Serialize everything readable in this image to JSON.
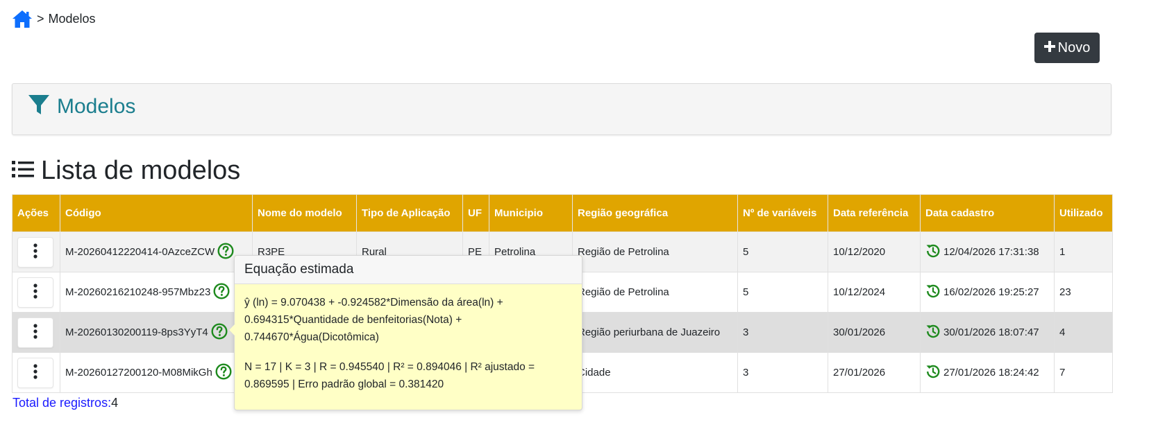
{
  "breadcrumb": {
    "separator": ">",
    "current": "Modelos"
  },
  "toolbar": {
    "novo_label": "Novo"
  },
  "filter_panel": {
    "title": "Modelos"
  },
  "list": {
    "title": "Lista de modelos"
  },
  "table": {
    "headers": [
      "Ações",
      "Código",
      "Nome do modelo",
      "Tipo de Aplicação",
      "UF",
      "Municipio",
      "Região geográfica",
      "Nº de variáveis",
      "Data referência",
      "Data cadastro",
      "Utilizado"
    ],
    "rows": [
      {
        "codigo": "M-20260412220414-0AzceZCW",
        "nome": "R3PE",
        "tipo": "Rural",
        "uf": "PE",
        "municipio": "Petrolina",
        "regiao": "Região de Petrolina",
        "variaveis": "5",
        "data_ref": "10/12/2020",
        "data_cadastro": "12/04/2026 17:31:38",
        "utilizado": "1"
      },
      {
        "codigo": "M-20260216210248-957Mbz23",
        "nome": "",
        "tipo": "",
        "uf": "",
        "municipio": "",
        "regiao": "Região de Petrolina",
        "variaveis": "5",
        "data_ref": "10/12/2024",
        "data_cadastro": "16/02/2026 19:25:27",
        "utilizado": "23"
      },
      {
        "codigo": "M-20260130200119-8ps3YyT4",
        "nome": "",
        "tipo": "",
        "uf": "",
        "municipio": "",
        "regiao": "Região periurbana de Juazeiro",
        "variaveis": "3",
        "data_ref": "30/01/2026",
        "data_cadastro": "30/01/2026 18:07:47",
        "utilizado": "4"
      },
      {
        "codigo": "M-20260127200120-M08MikGh",
        "nome": "",
        "tipo": "",
        "uf": "",
        "municipio": "",
        "regiao": "Cidade",
        "variaveis": "3",
        "data_ref": "27/01/2026",
        "data_cadastro": "27/01/2026 18:24:42",
        "utilizado": "7"
      }
    ]
  },
  "total": {
    "label": "Total de registros:",
    "value": "4"
  },
  "popover": {
    "title": "Equação estimada",
    "equation": "ŷ (ln) = 9.070438 + -0.924582*Dimensão da área(ln) + 0.694315*Quantidade de benfeitorias(Nota) + 0.744670*Água(Dicotômica)",
    "stats": "N = 17 | K = 3 | R = 0.945540 | R² = 0.894046 | R² ajustado = 0.869595 | Erro padrão global = 0.381420"
  },
  "colors": {
    "header": "#e0a500",
    "accent": "#1b7e8e",
    "help": "#1e8a1e",
    "history": "#1e8a1e",
    "popover_bg": "#ffffc6"
  },
  "icons": {
    "home": "home-icon",
    "plus": "plus-icon",
    "filter": "filter-icon",
    "list": "list-icon",
    "kebab": "kebab-icon",
    "help": "help-icon",
    "history": "history-icon"
  }
}
